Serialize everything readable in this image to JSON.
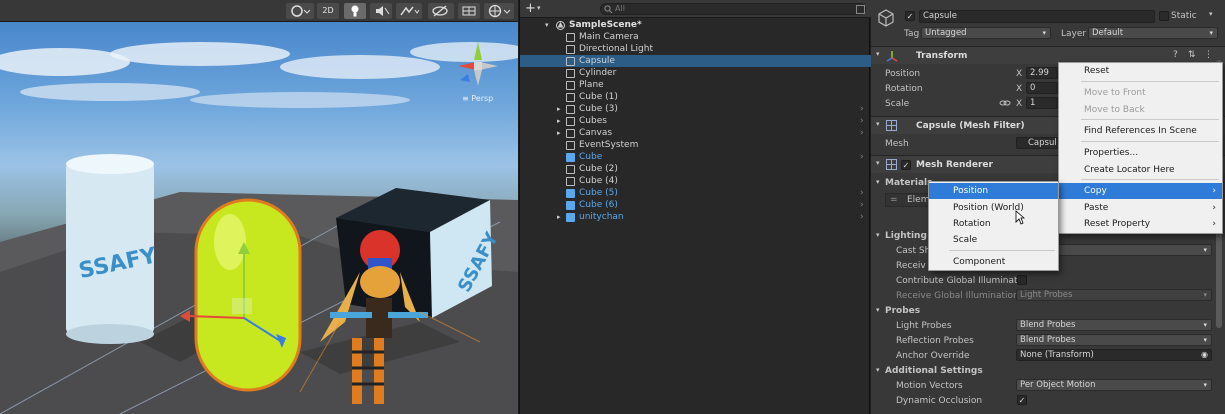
{
  "scene": {
    "toolbar": {
      "btn_2d": "2D",
      "persp": "≡ Persp"
    }
  },
  "hierarchy": {
    "add": "+",
    "search_placeholder": "All",
    "scene_name": "SampleScene*",
    "items": [
      {
        "label": "Main Camera",
        "type": "go"
      },
      {
        "label": "Directional Light",
        "type": "go"
      },
      {
        "label": "Capsule",
        "type": "go",
        "selected": true
      },
      {
        "label": "Cylinder",
        "type": "go"
      },
      {
        "label": "Plane",
        "type": "go"
      },
      {
        "label": "Cube (1)",
        "type": "go"
      },
      {
        "label": "Cube (3)",
        "type": "go",
        "expand": true
      },
      {
        "label": "Cubes",
        "type": "go",
        "expand": true
      },
      {
        "label": "Canvas",
        "type": "go",
        "expand": true
      },
      {
        "label": "EventSystem",
        "type": "go"
      },
      {
        "label": "Cube",
        "type": "prefab"
      },
      {
        "label": "Cube (2)",
        "type": "go"
      },
      {
        "label": "Cube (4)",
        "type": "go"
      },
      {
        "label": "Cube (5)",
        "type": "prefab"
      },
      {
        "label": "Cube (6)",
        "type": "prefab"
      },
      {
        "label": "unitychan",
        "type": "prefab",
        "expand": true
      }
    ]
  },
  "inspector": {
    "object_name": "Capsule",
    "static_label": "Static",
    "tag_label": "Tag",
    "tag_value": "Untagged",
    "layer_label": "Layer",
    "layer_value": "Default",
    "transform_title": "Transform",
    "position_label": "Position",
    "position_x": "2.99",
    "rotation_label": "Rotation",
    "rotation_x": "0",
    "scale_label": "Scale",
    "scale_x": "1",
    "x_label": "X",
    "meshfilter_title": "Capsule (Mesh Filter)",
    "mesh_label": "Mesh",
    "mesh_value": "Capsul",
    "meshrenderer_title": "Mesh Renderer",
    "materials_label": "Materials",
    "element_label": "Elem",
    "lighting_label": "Lighting",
    "cast_shadows": "Cast Sh",
    "receive_shadows": "Receiv",
    "contribute_gi": "Contribute Global Illuminatio",
    "receive_gi_label": "Receive Global Illumination",
    "receive_gi_value": "Light Probes",
    "probes_label": "Probes",
    "light_probes_label": "Light Probes",
    "light_probes_value": "Blend Probes",
    "reflection_probes_label": "Reflection Probes",
    "reflection_probes_value": "Blend Probes",
    "anchor_override_label": "Anchor Override",
    "anchor_override_value": "None (Transform)",
    "additional_label": "Additional Settings",
    "motion_vectors_label": "Motion Vectors",
    "motion_vectors_value": "Per Object Motion",
    "dynamic_occlusion_label": "Dynamic Occlusion"
  },
  "context_menu": {
    "items": [
      "Reset",
      "Move to Front",
      "Move to Back",
      "Find References In Scene",
      "Properties...",
      "Create Locator Here",
      "Copy",
      "Paste",
      "Reset Property"
    ],
    "arrow": "›"
  },
  "sub_menu": {
    "items": [
      "Position",
      "Position (World)",
      "Rotation",
      "Scale",
      "Component"
    ]
  },
  "colors": {
    "accent": "#2f7bd8",
    "selection": "#2c5d87",
    "prefab": "#5aa9f0",
    "gizmo_y": "#8fcf3a",
    "gizmo_x": "#e24a3b",
    "gizmo_z": "#3a7de2"
  }
}
